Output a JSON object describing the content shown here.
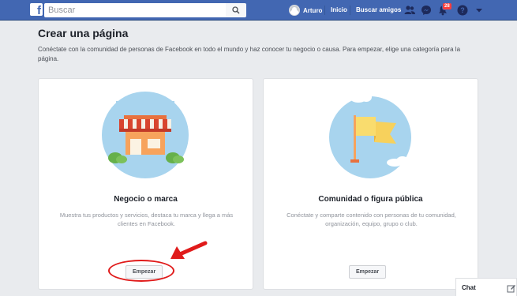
{
  "topbar": {
    "logo": "f",
    "search_placeholder": "Buscar",
    "user_name": "Arturo",
    "home_label": "Inicio",
    "find_friends_label": "Buscar amigos",
    "notifications_count": "28"
  },
  "page": {
    "title": "Crear una página",
    "description": "Conéctate con la comunidad de personas de Facebook en todo el mundo y haz conocer tu negocio o causa. Para empezar, elige una categoría para la página."
  },
  "cards": [
    {
      "title": "Negocio o marca",
      "description": "Muestra tus productos y servicios, destaca tu marca y llega a más clientes en Facebook.",
      "button": "Empezar"
    },
    {
      "title": "Comunidad o figura pública",
      "description": "Conéctate y comparte contenido con personas de tu comunidad, organización, equipo, grupo o club.",
      "button": "Empezar"
    }
  ],
  "chat": {
    "label": "Chat"
  },
  "colors": {
    "brand": "#4267b2",
    "page_bg": "#e9ebee",
    "annotation": "#e01b1b"
  }
}
